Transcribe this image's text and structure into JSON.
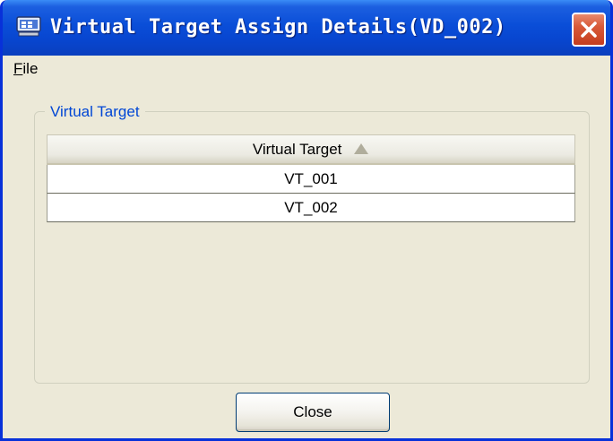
{
  "window": {
    "title": "Virtual Target Assign Details(VD_002)",
    "app_icon": "monitor-app-icon",
    "close_icon": "close-x-icon"
  },
  "menu": {
    "file_mnemonic": "F",
    "file_rest": "ile"
  },
  "group": {
    "legend": "Virtual Target"
  },
  "table": {
    "column_header": "Virtual Target",
    "sort_icon": "sort-ascending-icon",
    "rows": [
      "VT_001",
      "VT_002"
    ]
  },
  "buttons": {
    "close_label": "Close"
  },
  "colors": {
    "titlebar": "#0a4ed8",
    "close_button": "#d85a38",
    "window_bg": "#ece9d8",
    "legend_text": "#0046d5"
  }
}
